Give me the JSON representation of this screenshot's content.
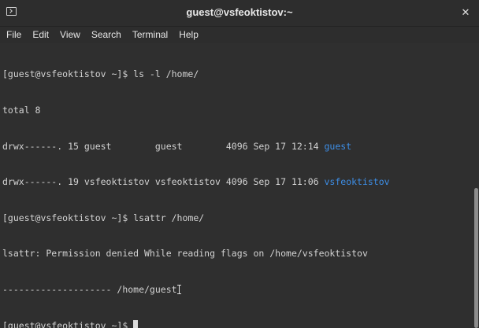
{
  "window": {
    "title": "guest@vsfeoktistov:~",
    "close_glyph": "✕"
  },
  "menu": [
    "File",
    "Edit",
    "View",
    "Search",
    "Terminal",
    "Help"
  ],
  "terminal": {
    "lines": [
      "[guest@vsfeoktistov ~]$ ls -l /home/",
      "total 8",
      "drwx------. 15 guest        guest        4096 Sep 17 12:14 ",
      "drwx------. 19 vsfeoktistov vsfeoktistov 4096 Sep 17 11:06 ",
      "[guest@vsfeoktistov ~]$ lsattr /home/",
      "lsattr: Permission denied While reading flags on /home/vsfeoktistov",
      "-------------------- /home/guest",
      "[guest@vsfeoktistov ~]$ "
    ],
    "dir_names": [
      "guest",
      "vsfeoktistov"
    ],
    "dir_color": "#3d8ee6",
    "text_color": "#d3d3d3",
    "background": "#2f2f2f"
  },
  "icons": {
    "terminal": "terminal-icon",
    "close": "close-icon",
    "cursor": "text-cursor-icon"
  }
}
